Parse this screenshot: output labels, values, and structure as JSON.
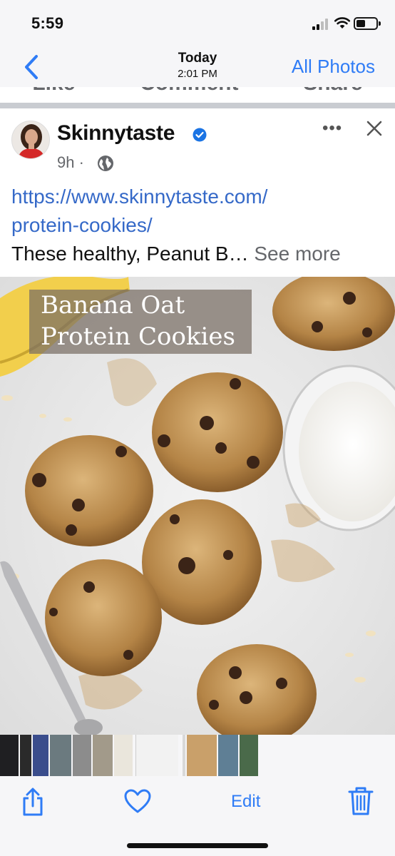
{
  "status_bar": {
    "time": "5:59"
  },
  "nav": {
    "title": "Today",
    "subtitle": "2:01 PM",
    "all_photos": "All Photos"
  },
  "post": {
    "cut_actions": [
      "Like",
      "Comment",
      "Share"
    ],
    "page_name": "Skinnytaste",
    "time": "9h",
    "separator": "·",
    "link_line1": "https://www.skinnytaste.com/",
    "link_line2": "protein-cookies/",
    "text": "These healthy, Peanut B…",
    "see_more": "See more",
    "more": "•••"
  },
  "photo_caption": {
    "line1": "Banana Oat",
    "line2": "Protein Cookies"
  },
  "toolbar": {
    "edit": "Edit"
  },
  "icons": [
    "back-chevron-icon",
    "signal-icon",
    "wifi-icon",
    "battery-icon",
    "verified-badge-icon",
    "globe-icon",
    "more-icon",
    "close-icon",
    "share-icon",
    "heart-icon",
    "trash-icon"
  ],
  "colors": {
    "accent": "#2f7cf6",
    "link": "#3569c8",
    "facebook_grey": "#65676b"
  }
}
